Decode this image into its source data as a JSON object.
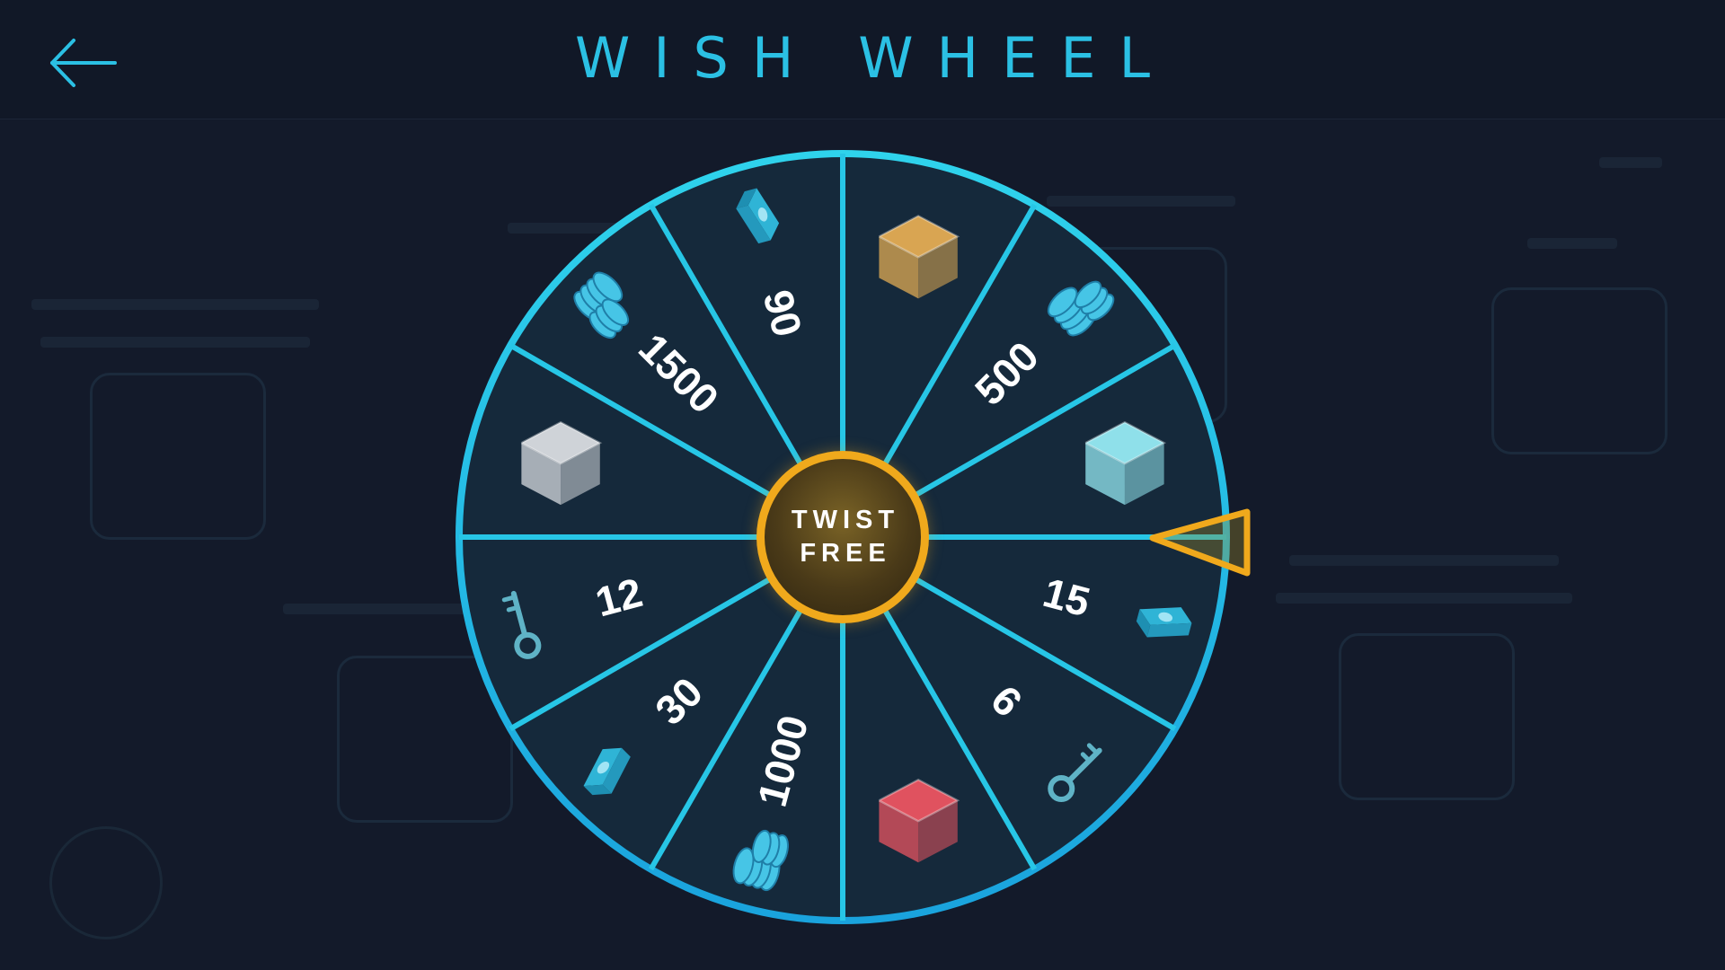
{
  "header": {
    "title": "WISH WHEEL",
    "back_icon": "arrow-left-icon"
  },
  "wheel": {
    "center_button": {
      "line1": "TWIST",
      "line2": "FREE"
    },
    "pointer_icon": "pointer-triangle-icon",
    "colors": {
      "rim": "#27c6e6",
      "pointer": "#f0a91c",
      "center_ring": "#f0a91c"
    },
    "segments": [
      {
        "label": "",
        "icon": "gold-cube-icon",
        "color": "#d9a552"
      },
      {
        "label": "500",
        "icon": "coins-icon",
        "color": "#46c5e6"
      },
      {
        "label": "",
        "icon": "ice-cube-icon",
        "color": "#8fe0ea"
      },
      {
        "label": "15",
        "icon": "cash-icon",
        "color": "#2fb4d6"
      },
      {
        "label": "6",
        "icon": "key-icon",
        "color": "#5fb3c6"
      },
      {
        "label": "",
        "icon": "red-cube-icon",
        "color": "#e0525f"
      },
      {
        "label": "1000",
        "icon": "coins-icon",
        "color": "#46c5e6"
      },
      {
        "label": "30",
        "icon": "cash-icon",
        "color": "#2fb4d6"
      },
      {
        "label": "12",
        "icon": "key-icon",
        "color": "#5fb3c6"
      },
      {
        "label": "",
        "icon": "silver-cube-icon",
        "color": "#cfd3d8"
      },
      {
        "label": "1500",
        "icon": "coins-icon",
        "color": "#46c5e6"
      },
      {
        "label": "90",
        "icon": "cash-icon",
        "color": "#2fb4d6"
      }
    ]
  }
}
